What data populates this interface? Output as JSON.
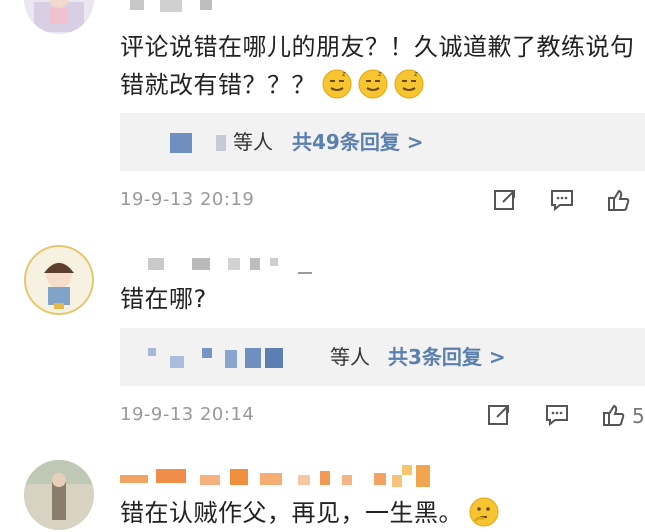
{
  "comments": [
    {
      "text": "评论说错在哪儿的朋友？！久诚道歉了教练说句错就改有错？？？",
      "replies": {
        "names": "等人",
        "count": "共49条回复 >"
      },
      "time": "19-9-13 20:19"
    },
    {
      "text": "错在哪?",
      "replies": {
        "names": "等人",
        "count": "共3条回复 >"
      },
      "time": "19-9-13 20:14",
      "likes_partial": "5"
    },
    {
      "text": "错在认贼作父，再见，一生黑。"
    }
  ],
  "icons": [
    "share-icon",
    "comment-icon",
    "like-icon",
    "emoji-smirk-icon",
    "emoji-thinking-icon"
  ],
  "colors": {
    "link": "#5b7fae",
    "meta": "#999999",
    "reply_bg": "#f2f2f2"
  }
}
